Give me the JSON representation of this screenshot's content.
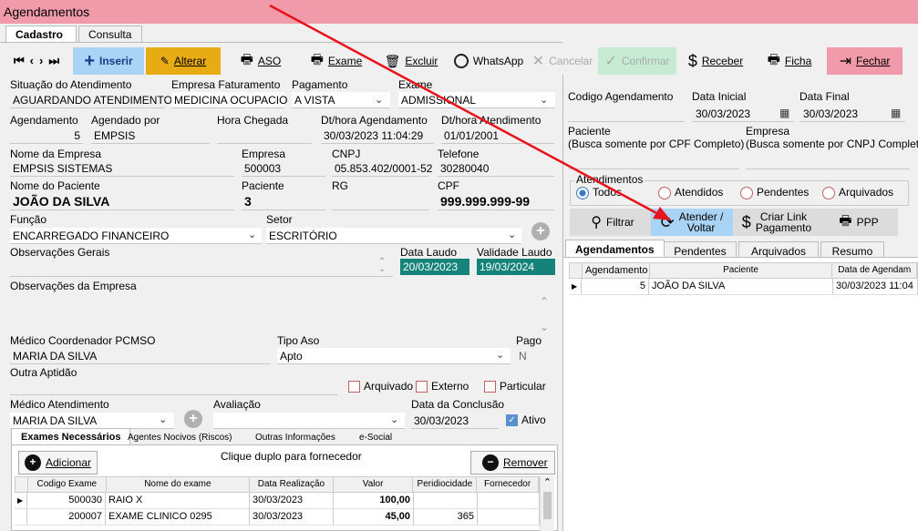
{
  "window": {
    "title": "Agendamentos"
  },
  "tabs": {
    "cadastro": "Cadastro",
    "consulta": "Consulta"
  },
  "toolbar": {
    "inserir": "Inserir",
    "alterar": "Alterar",
    "aso": "ASO",
    "exame": "Exame",
    "excluir": "Excluir",
    "whatsapp": "WhatsApp",
    "cancelar": "Cancelar",
    "confirmar": "Confirmar",
    "receber": "Receber",
    "ficha": "Ficha",
    "fechar": "Fechar"
  },
  "form": {
    "situacao_label": "Situação do Atendimento",
    "situacao_value": "AGUARDANDO ATENDIMENTO",
    "empresa_fat_label": "Empresa Faturamento",
    "empresa_fat_value": "MEDICINA OCUPACIO",
    "pagamento_label": "Pagamento",
    "pagamento_value": "A VISTA",
    "exame_label": "Exame",
    "exame_value": "ADMISSIONAL",
    "agendamento_label": "Agendamento",
    "agendamento_value": "5",
    "agendado_por_label": "Agendado por",
    "agendado_por_value": "EMPSIS",
    "hora_chegada_label": "Hora Chegada",
    "dt_agendamento_label": "Dt/hora Agendamento",
    "dt_agendamento_value": "30/03/2023 11:04:29",
    "dt_atendimento_label": "Dt/hora Atendimento",
    "dt_atendimento_value": "01/01/2001",
    "nome_empresa_label": "Nome da Empresa",
    "nome_empresa_value": "EMPSIS SISTEMAS",
    "empresa_label": "Empresa",
    "empresa_value": "500003",
    "cnpj_label": "CNPJ",
    "cnpj_value": "05.853.402/0001-52",
    "telefone_label": "Telefone",
    "telefone_value": "30280040",
    "nome_paciente_label": "Nome do Paciente",
    "nome_paciente_value": "JOÃO DA SILVA",
    "paciente_label": "Paciente",
    "paciente_value": "3",
    "rg_label": "RG",
    "cpf_label": "CPF",
    "cpf_value": "999.999.999-99",
    "funcao_label": "Função",
    "funcao_value": "ENCARREGADO FINANCEIRO",
    "setor_label": "Setor",
    "setor_value": "ESCRITÓRIO",
    "obs_gerais_label": "Observações Gerais",
    "data_laudo_label": "Data Laudo",
    "data_laudo_value": "20/03/2023",
    "validade_laudo_label": "Validade Laudo",
    "validade_laudo_value": "19/03/2024",
    "obs_empresa_label": "Observações da Empresa",
    "medico_coord_label": "Médico Coordenador PCMSO",
    "medico_coord_value": "MARIA DA SILVA",
    "tipo_aso_label": "Tipo Aso",
    "tipo_aso_value": "Apto",
    "pago_label": "Pago",
    "pago_value": "N",
    "outra_aptidao_label": "Outra Aptidão",
    "arquivado_label": "Arquivado",
    "externo_label": "Externo",
    "particular_label": "Particular",
    "medico_atend_label": "Médico Atendimento",
    "medico_atend_value": "MARIA DA SILVA",
    "avaliacao_label": "Avaliação",
    "data_conclusao_label": "Data da Conclusão",
    "data_conclusao_value": "30/03/2023",
    "ativo_label": "Ativo"
  },
  "exames": {
    "tabs": [
      "Exames Necessários",
      "Agentes Nocivos (Riscos)",
      "Outras Informações",
      "e-Social"
    ],
    "adicionar": "Adicionar",
    "remover": "Remover",
    "hint": "Clique duplo para fornecedor",
    "columns": [
      "Codigo Exame",
      "Nome do exame",
      "Data Realização",
      "Valor",
      "Peridiocidade",
      "Fornecedor"
    ],
    "rows": [
      {
        "codigo": "500030",
        "nome": "RAIO X",
        "data": "30/03/2023",
        "valor": "100,00",
        "period": "",
        "fornecedor": ""
      },
      {
        "codigo": "200007",
        "nome": "EXAME CLINICO 0295",
        "data": "30/03/2023",
        "valor": "45,00",
        "period": "365",
        "fornecedor": ""
      }
    ]
  },
  "right": {
    "codigo_label": "Codigo Agendamento",
    "data_inicial_label": "Data Inicial",
    "data_inicial_value": "30/03/2023",
    "data_final_label": "Data Final",
    "data_final_value": "30/03/2023",
    "paciente_label": "Paciente",
    "paciente_hint": "(Busca somente por CPF Completo)",
    "empresa_label": "Empresa",
    "empresa_hint": "(Busca somente por CNPJ Completo)",
    "atendimentos_label": "Atendimentos",
    "radios": [
      "Todos",
      "Atendidos",
      "Pendentes",
      "Arquivados"
    ],
    "filtrar": "Filtrar",
    "atender_1": "Atender /",
    "atender_2": "Voltar",
    "criar_1": "Criar Link",
    "criar_2": "Pagamento",
    "ppp": "PPP",
    "tabs": [
      "Agendamentos",
      "Pendentes",
      "Arquivados",
      "Resumo"
    ],
    "columns": [
      "Agendamento",
      "Paciente",
      "Data de Agendam"
    ],
    "rows": [
      {
        "agendamento": "5",
        "paciente": "JOÃO DA SILVA",
        "data": "30/03/2023 11:04"
      }
    ]
  },
  "colors": {
    "title": "#f09aaa",
    "inserir": "#aad4f5",
    "alterar": "#e7ac14",
    "fechar": "#f09aaa",
    "laudo": "#16837a",
    "arrow": "#e8141b"
  }
}
